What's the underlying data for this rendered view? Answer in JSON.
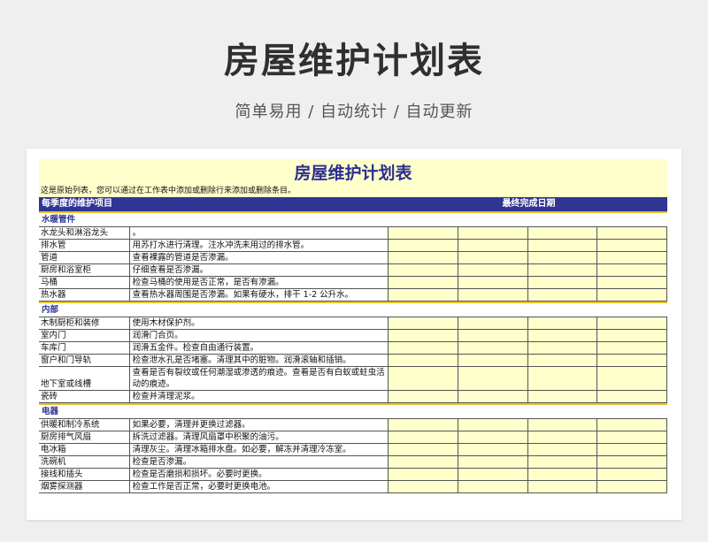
{
  "hero": {
    "title": "房屋维护计划表",
    "subtitle": "简单易用  /  自动统计  /  自动更新"
  },
  "sheet": {
    "title": "房屋维护计划表",
    "intro": "这是原始列表，您可以通过在工作表中添加或删除行来添加或删除条目。",
    "col_item": "每季度的维护项目",
    "col_date": "最终完成日期",
    "sections": [
      {
        "name": "水暖管件",
        "rows": [
          {
            "item": "水龙头和淋浴龙头",
            "desc": "。"
          },
          {
            "item": "排水管",
            "desc": "用苏打水进行清理。注水冲洗未用过的排水管。"
          },
          {
            "item": "管道",
            "desc": "查看裸露的管道是否渗漏。"
          },
          {
            "item": "厨房和浴室柜",
            "desc": "仔细查看是否渗漏。"
          },
          {
            "item": "马桶",
            "desc": "检查马桶的使用是否正常，是否有渗漏。"
          },
          {
            "item": "热水器",
            "desc": "查看热水器周围是否渗漏。如果有硬水，排干 1-2 公升水。"
          }
        ]
      },
      {
        "name": "内部",
        "rows": [
          {
            "item": "木制厨柜和装修",
            "desc": "使用木材保护剂。"
          },
          {
            "item": "室内门",
            "desc": "润滑门合页。"
          },
          {
            "item": "车库门",
            "desc": "润滑五金件。检查自由通行装置。"
          },
          {
            "item": "窗户和门导轨",
            "desc": "检查泄水孔是否堵塞。清理其中的脏物。润滑滚轴和插销。"
          },
          {
            "item": "地下室或线槽",
            "desc": "查看是否有裂纹或任何潮湿或渗透的痕迹。查看是否有白蚁或蛀虫活动的痕迹。"
          },
          {
            "item": "瓷砖",
            "desc": "检查并清理泥浆。"
          }
        ]
      },
      {
        "name": "电器",
        "rows": [
          {
            "item": "供暖和制冷系统",
            "desc": "如果必要，清理并更换过滤器。"
          },
          {
            "item": "厨房排气风扇",
            "desc": "拆洗过滤器。清理风扇罩中积聚的油污。"
          },
          {
            "item": "电冰箱",
            "desc": "清理灰尘。清理冰箱排水盘。如必要，解冻并清理冷冻室。"
          },
          {
            "item": "洗碗机",
            "desc": "检查是否渗漏。"
          },
          {
            "item": "接线和插头",
            "desc": "检查是否磨损和损坏。必要时更换。"
          },
          {
            "item": "烟雾探测器",
            "desc": "检查工作是否正常，必要时更换电池。"
          }
        ]
      }
    ]
  }
}
